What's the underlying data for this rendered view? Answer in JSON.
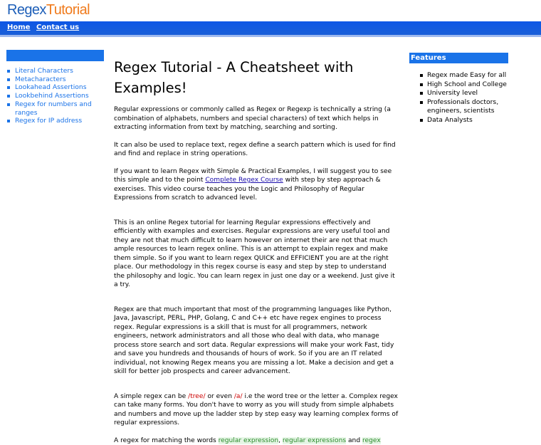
{
  "header": {
    "logo_part1": "Regex",
    "logo_part2": "Tutorial"
  },
  "nav": {
    "home": "Home",
    "contact": "Contact us"
  },
  "sidebar": {
    "items": [
      "Literal Characters",
      "Metacharacters",
      "Lookahead Assertions",
      "Lookbehind Assertions",
      "Regex for numbers and ranges",
      "Regex for IP address"
    ]
  },
  "main": {
    "title": "Regex Tutorial - A Cheatsheet with Examples!",
    "p1": "Regular expressions or commonly called as Regex or Regexp is technically a string (a combination of alphabets, numbers and special characters) of text which helps in extracting information from text by matching, searching and sorting.",
    "p2": "It can also be used to replace text, regex define a search pattern which is used for find and find and replace in string operations.",
    "p3_before": "If you want to learn Regex with Simple & Practical Examples, I will suggest you to see this simple and to the point ",
    "p3_link": "Complete Regex Course",
    "p3_after": " with step by step approach & exercises. This video course teaches you the Logic and Philosophy of Regular Expressions from scratch to advanced level.",
    "p4": "This is an online Regex tutorial for learning Regular expressions effectively and efficiently with examples and exercises. Regular expressions are very useful tool and they are not that much difficult to learn however on internet their are not that much ample resources to learn regex online. This is an attempt to explain regex and make them simple. So if you want to learn regex QUICK and EFFICIENT you are at the right place. Our methodology in this regex course is easy and step by step to understand the philosophy and logic. You can learn regex in just one day or a weekend. Just give it a try.",
    "p5": "Regex are that much important that most of the programming languages like Python, Java, Javascript, PERL, PHP, Golang, C and C++ etc have regex engines to process regex. Regular expressions is a skill that is must for all programmers, network engineers, network administrators and all those who deal with data, who manage process store search and sort data. Regular expressions will make your work Fast, tidy and save you hundreds and thousands of hours of work. So if you are an IT related individual, not knowing Regex means you are missing a lot. Make a decision and get a skill for better job prospects and career advancement.",
    "p6_a": "A simple regex can be ",
    "p6_code1": "/tree/",
    "p6_b": " or even ",
    "p6_code2": "/a/",
    "p6_c": " i.e the word tree or the letter a. Complex regex can take many forms. You don't have to worry as you will study from simple alphabets and numbers and move up the ladder step by step easy way learning complex forms of regular expressions.",
    "p7_a": "A regex for matching the words ",
    "p7_code1": "regular expression",
    "p7_b": ", ",
    "p7_code2": "regular expressions",
    "p7_c": " and ",
    "p7_code3": "regex"
  },
  "features": {
    "heading": "Features",
    "items": [
      "Regex made Easy for all",
      "High School and College",
      "University level",
      "Professionals doctors, engineers, scientists",
      "Data Analysts"
    ]
  },
  "colors": {
    "nav_blue": "#0d56e6",
    "accent_blue": "#1a73e8",
    "logo_blue": "#1e5fb8",
    "logo_orange": "#f07b1d"
  }
}
